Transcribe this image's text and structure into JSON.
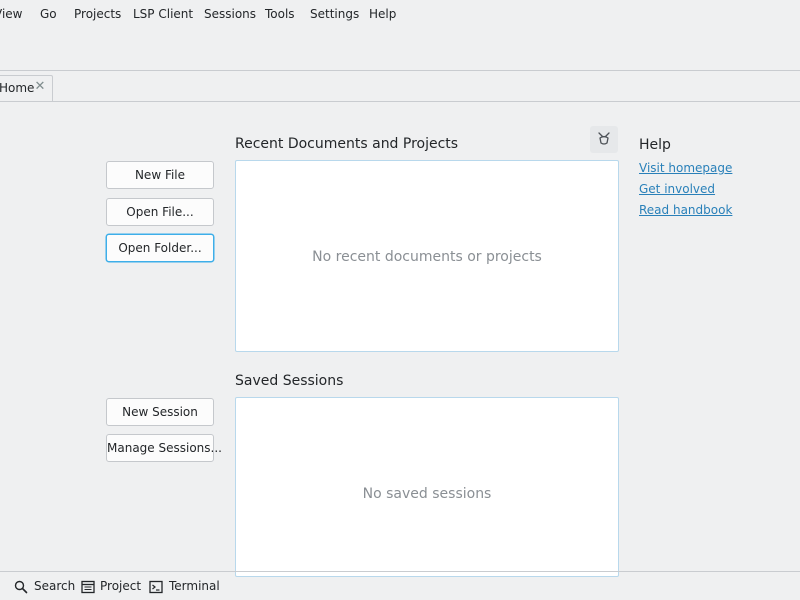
{
  "menubar": {
    "items": [
      "View",
      "Go",
      "Projects",
      "LSP Client",
      "Sessions",
      "Tools",
      "Settings",
      "Help"
    ]
  },
  "tabs": [
    {
      "label": "Home",
      "close_icon": "close-icon"
    }
  ],
  "actions": {
    "new_file": "New File",
    "open_file": "Open File...",
    "open_folder": "Open Folder...",
    "new_session": "New Session",
    "manage_sessions": "Manage Sessions..."
  },
  "recent": {
    "title": "Recent Documents and Projects",
    "empty_text": "No recent documents or projects",
    "clear_icon": "clear-history-icon"
  },
  "sessions": {
    "title": "Saved Sessions",
    "empty_text": "No saved sessions"
  },
  "help": {
    "title": "Help",
    "links": [
      "Visit homepage",
      "Get involved",
      "Read handbook"
    ]
  },
  "statusbar": {
    "items": [
      {
        "label": "Search",
        "icon": "search-icon"
      },
      {
        "label": "Project",
        "icon": "project-icon"
      },
      {
        "label": "Terminal",
        "icon": "terminal-icon"
      }
    ]
  },
  "colors": {
    "background": "#eff0f1",
    "accent": "#3daee9",
    "link": "#2980b9",
    "panel_border": "#b8d8ec"
  }
}
